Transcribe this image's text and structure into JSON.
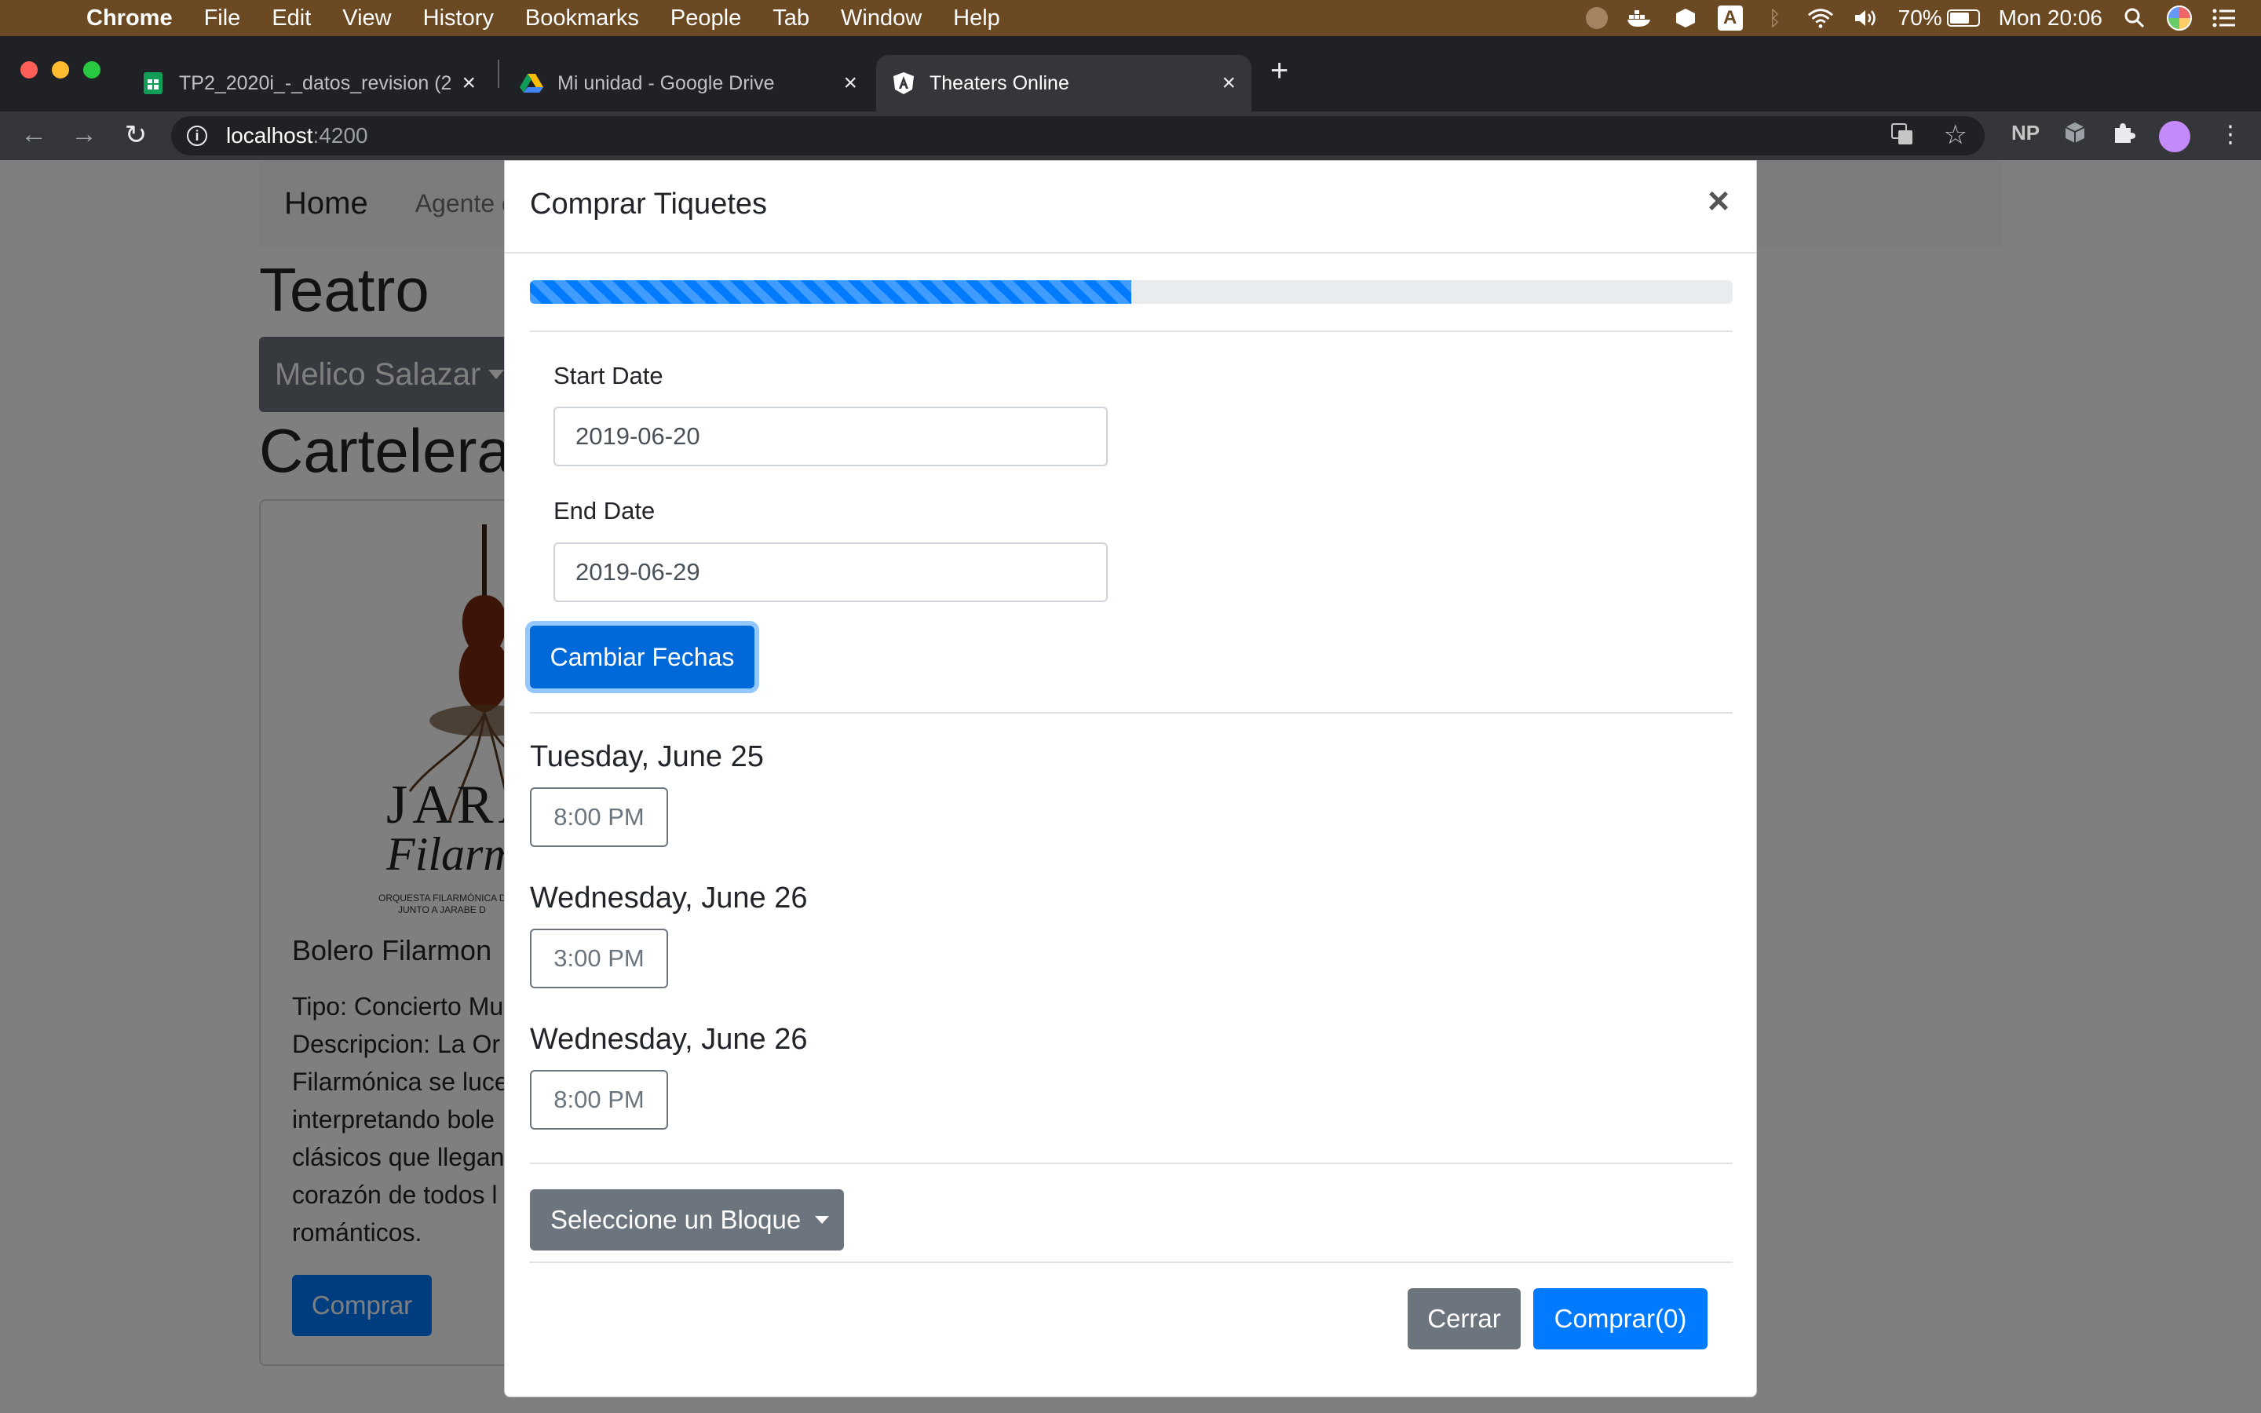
{
  "menubar": {
    "app_name": "Chrome",
    "items": [
      "File",
      "Edit",
      "View",
      "History",
      "Bookmarks",
      "People",
      "Tab",
      "Window",
      "Help"
    ],
    "battery_percent": "70%",
    "clock": "Mon 20:06",
    "battery_level": 0.7
  },
  "tabs": [
    {
      "title": "TP2_2020i_-_datos_revision (2",
      "icon": "google-sheets-icon"
    },
    {
      "title": "Mi unidad - Google Drive",
      "icon": "google-drive-icon"
    },
    {
      "title": "Theaters Online",
      "icon": "angular-icon"
    }
  ],
  "address_bar": {
    "host": "localhost",
    "port": ":4200"
  },
  "toolbar_icons": {
    "extension_label": "NP"
  },
  "background_page": {
    "nav": {
      "brand": "Home",
      "link": "Agente d"
    },
    "heading": "Teatro",
    "theater_dropdown": "Melico Salazar",
    "section_heading": "Cartelera",
    "card": {
      "title": "Bolero Filarmon",
      "lines": [
        "Tipo: Concierto Mu",
        "Descripcion: La Or",
        "Filarmónica se luce",
        "interpretando bole",
        "clásicos que llegan",
        "corazón de todos l",
        "románticos."
      ],
      "buy_label": "Comprar"
    },
    "poster": {
      "word1": "JARA",
      "word2": "Filarmó",
      "subtitle1": "ORQUESTA FILARMÓNICA D",
      "subtitle2": "JUNTO A JARABE D"
    }
  },
  "modal": {
    "title": "Comprar Tiquetes",
    "close_symbol": "×",
    "progress_fraction": 0.5,
    "start_date_label": "Start Date",
    "start_date_value": "2019-06-20",
    "end_date_label": "End Date",
    "end_date_value": "2019-06-29",
    "change_dates_label": "Cambiar Fechas",
    "schedule": [
      {
        "day": "Tuesday, June 25",
        "time": "8:00 PM"
      },
      {
        "day": "Wednesday, June 26",
        "time": "3:00 PM"
      },
      {
        "day": "Wednesday, June 26",
        "time": "8:00 PM"
      }
    ],
    "block_dropdown_label": "Seleccione un Bloque",
    "close_button_label": "Cerrar",
    "buy_button_label": "Comprar(0)"
  },
  "colors": {
    "primary": "#007bff",
    "secondary": "#6c757d",
    "menubar": "#6b4a23"
  }
}
